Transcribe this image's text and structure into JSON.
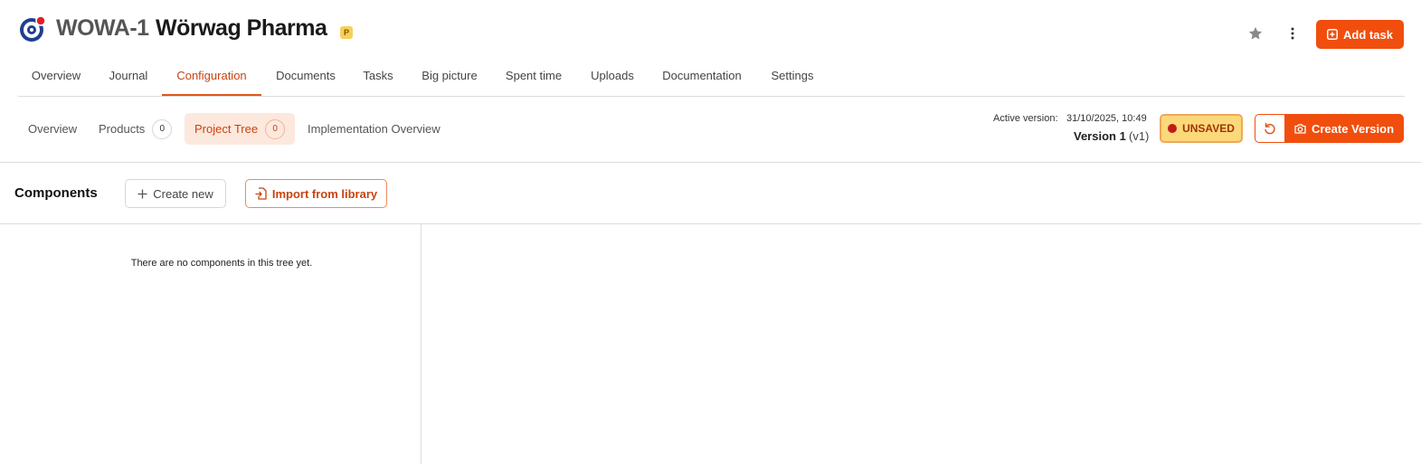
{
  "header": {
    "project_code": "WOWA-1",
    "project_name": "Wörwag Pharma",
    "badge": "P",
    "add_task_label": "Add task"
  },
  "main_tabs": [
    {
      "label": "Overview",
      "active": false
    },
    {
      "label": "Journal",
      "active": false
    },
    {
      "label": "Configuration",
      "active": true
    },
    {
      "label": "Documents",
      "active": false
    },
    {
      "label": "Tasks",
      "active": false
    },
    {
      "label": "Big picture",
      "active": false
    },
    {
      "label": "Spent time",
      "active": false
    },
    {
      "label": "Uploads",
      "active": false
    },
    {
      "label": "Documentation",
      "active": false
    },
    {
      "label": "Settings",
      "active": false
    }
  ],
  "sub_tabs": [
    {
      "label": "Overview",
      "count": null,
      "active": false
    },
    {
      "label": "Products",
      "count": "0",
      "active": false
    },
    {
      "label": "Project Tree",
      "count": "0",
      "active": true
    },
    {
      "label": "Implementation Overview",
      "count": null,
      "active": false
    }
  ],
  "version": {
    "active_label": "Active version:",
    "active_value": "31/10/2025, 10:49",
    "name": "Version 1",
    "code": "(v1)",
    "status": "UNSAVED",
    "create_label": "Create Version"
  },
  "components": {
    "title": "Components",
    "create_new_label": "Create new",
    "import_label": "Import from library",
    "empty_message": "There are no components in this tree yet."
  },
  "colors": {
    "accent": "#f14e0e",
    "accent_text": "#c9430f",
    "unsaved_bg": "#fbd97a",
    "unsaved_dot": "#c21a1a"
  },
  "icons": {
    "logo": "target-logo-icon",
    "star": "star-icon",
    "more": "kebab-menu-icon",
    "add_task": "plus-square-icon",
    "revert": "undo-icon",
    "create_version": "camera-icon",
    "create_new": "plus-icon",
    "import": "file-import-icon"
  }
}
